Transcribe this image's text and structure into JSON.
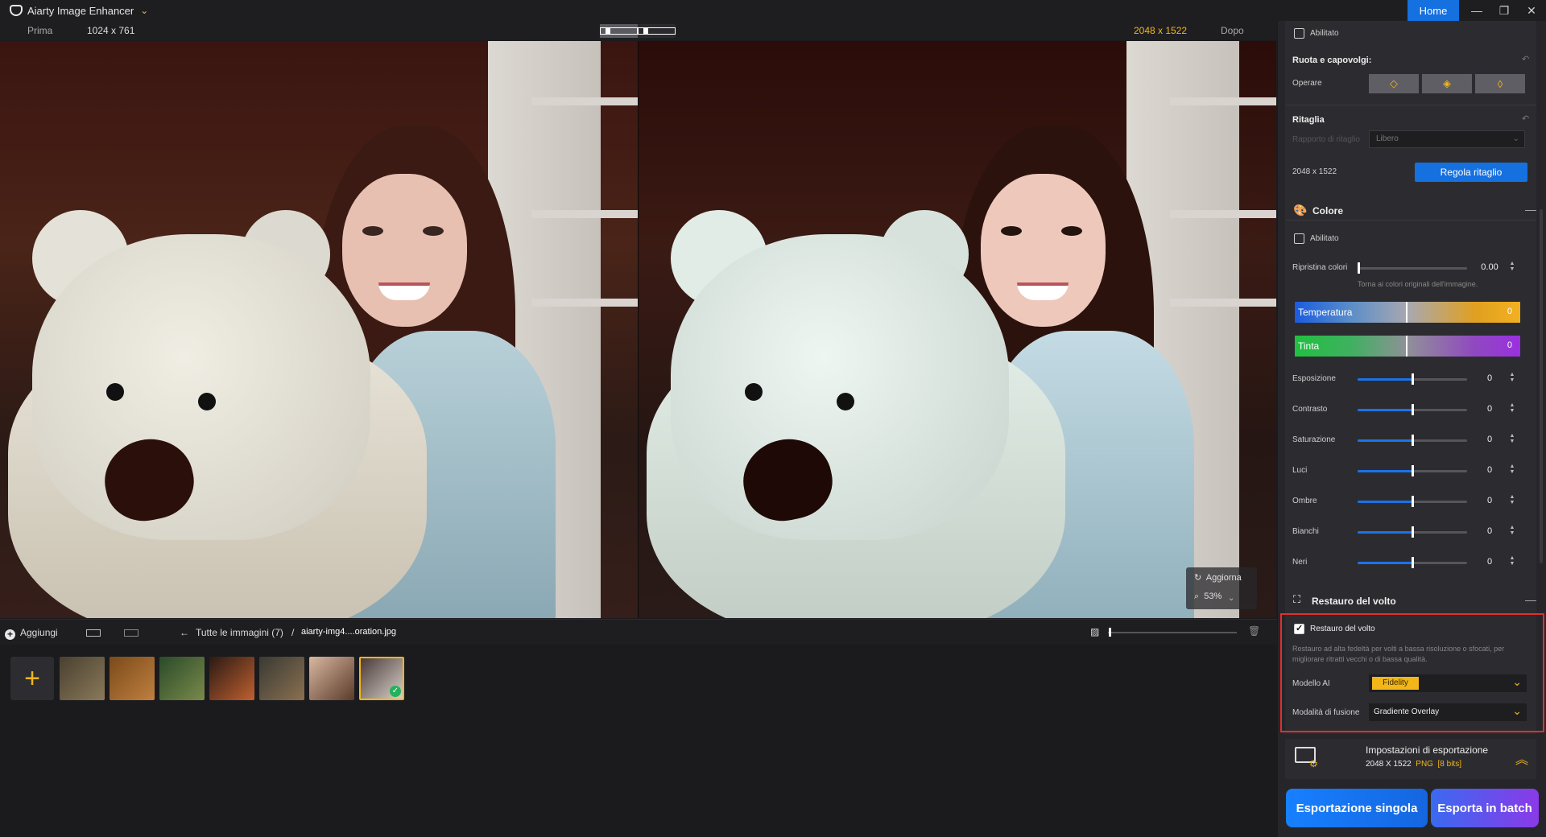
{
  "app": {
    "title": "Aiarty Image Enhancer",
    "home_label": "Home"
  },
  "window_controls": {
    "minimize": "—",
    "restore": "❐",
    "close": "✕"
  },
  "compare": {
    "before_label": "Prima",
    "before_size": "1024 x 761",
    "after_size": "2048 x 1522",
    "after_label": "Dopo"
  },
  "canvas": {
    "refresh_label": "Aggiorna",
    "zoom": "53%"
  },
  "bottombar": {
    "add_label": "Aggiungi",
    "all_images": "Tutte le immagini (7)",
    "separator": "/",
    "filename": "aiarty-img4....oration.jpg",
    "zoom_level": 0.02
  },
  "thumbnails": [
    {
      "name": "owl",
      "colors": [
        "#4a4030",
        "#8a7a5a"
      ]
    },
    {
      "name": "tiger",
      "colors": [
        "#7a4a1a",
        "#c08040"
      ]
    },
    {
      "name": "forest-cat",
      "colors": [
        "#2a4a2a",
        "#7a8a4a"
      ]
    },
    {
      "name": "burger",
      "colors": [
        "#2a1a14",
        "#c06030"
      ]
    },
    {
      "name": "dog",
      "colors": [
        "#3a3a34",
        "#8a7050"
      ]
    },
    {
      "name": "woman",
      "colors": [
        "#d8b8a0",
        "#5a3a2a"
      ]
    },
    {
      "name": "bear-girl",
      "colors": [
        "#4a3a3a",
        "#d8d0c8"
      ]
    }
  ],
  "panel": {
    "top_checkbox": "Abilitato",
    "rotate": {
      "title": "Ruota e capovolgi:",
      "operate_label": "Operare",
      "buttons": [
        "◇",
        "◈",
        "◊"
      ]
    },
    "crop": {
      "title": "Ritaglia",
      "ratio_label": "Rapporto di ritaglio",
      "ratio_value": "Libero",
      "size": "2048 x 1522",
      "adjust_button": "Regola ritaglio"
    },
    "color": {
      "title": "Colore",
      "enabled_label": "Abilitato",
      "reset_label": "Ripristina colori",
      "reset_value": "0.00",
      "reset_hint": "Torna ai colori originali dell'immagine.",
      "temperature": {
        "label": "Temperatura",
        "value": "0"
      },
      "tint": {
        "label": "Tinta",
        "value": "0"
      },
      "sliders": [
        {
          "label": "Esposizione",
          "value": "0"
        },
        {
          "label": "Contrasto",
          "value": "0"
        },
        {
          "label": "Saturazione",
          "value": "0"
        },
        {
          "label": "Luci",
          "value": "0"
        },
        {
          "label": "Ombre",
          "value": "0"
        },
        {
          "label": "Bianchi",
          "value": "0"
        },
        {
          "label": "Neri",
          "value": "0"
        }
      ]
    },
    "face": {
      "title": "Restauro del volto",
      "checkbox_label": "Restauro del volto",
      "description": "Restauro ad alta fedeltà per volti a bassa risoluzione o sfocati, per migliorare ritratti vecchi o di bassa qualità.",
      "model_label": "Modello AI",
      "model_value": "Fidelity",
      "blend_label": "Modalità di fusione",
      "blend_value": "Gradiente Overlay"
    },
    "export": {
      "title": "Impostazioni di esportazione",
      "size": "2048 X 1522",
      "format": "PNG",
      "bits": "[8 bits]",
      "single_button": "Esportazione singola",
      "batch_button": "Esporta in batch"
    }
  },
  "colors": {
    "accent": "#f2b61a",
    "primary": "#1570e0",
    "highlight": "#e03030"
  }
}
